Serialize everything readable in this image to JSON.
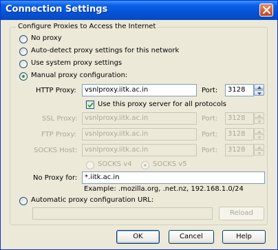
{
  "window": {
    "title": "Connection Settings"
  },
  "group": {
    "legend": "Configure Proxies to Access the Internet"
  },
  "options": {
    "no_proxy": "No proxy",
    "auto_detect": "Auto-detect proxy settings for this network",
    "system": "Use system proxy settings",
    "manual": "Manual proxy configuration:",
    "auto_url": "Automatic proxy configuration URL:"
  },
  "selected_option": "manual",
  "manual": {
    "http_label": "HTTP Proxy:",
    "http_value": "vsnlproxy.iitk.ac.in",
    "port_label": "Port:",
    "http_port": "3128",
    "use_all_label": "Use this proxy server for all protocols",
    "use_all_checked": true,
    "ssl_label": "SSL Proxy:",
    "ssl_value": "vsnlproxy.iitk.ac.in",
    "ssl_port": "3128",
    "ftp_label": "FTP Proxy:",
    "ftp_value": "vsnlproxy.iitk.ac.in",
    "ftp_port": "3128",
    "socks_label": "SOCKS Host:",
    "socks_value": "vsnlproxy.iitk.ac.in",
    "socks_port": "3128",
    "socks_v4": "SOCKS v4",
    "socks_v5": "SOCKS v5",
    "socks_selected": "v5",
    "no_proxy_label": "No Proxy for:",
    "no_proxy_value": "*.iitk.ac.in",
    "example": "Example: .mozilla.org, .net.nz, 192.168.1.0/24"
  },
  "auto_url_value": "",
  "reload_label": "Reload",
  "buttons": {
    "ok": "OK",
    "cancel": "Cancel",
    "help": "Help"
  },
  "colors": {
    "titlebar": "#0554d6",
    "dialog_bg": "#ece9d8",
    "radio_dot": "#21a121"
  }
}
